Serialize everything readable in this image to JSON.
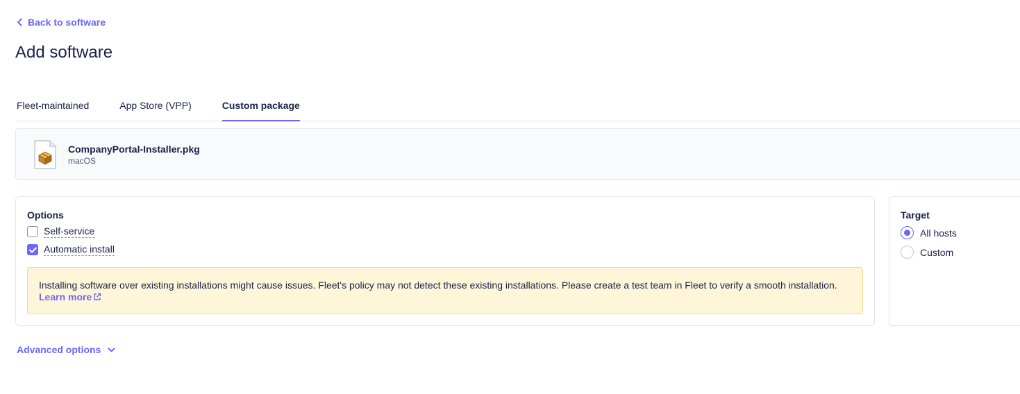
{
  "header": {
    "back_label": "Back to software",
    "title": "Add software"
  },
  "tabs": [
    {
      "label": "Fleet-maintained",
      "active": false
    },
    {
      "label": "App Store (VPP)",
      "active": false
    },
    {
      "label": "Custom package",
      "active": true
    }
  ],
  "file": {
    "name": "CompanyPortal-Installer.pkg",
    "platform": "macOS",
    "icon": "package-icon"
  },
  "options": {
    "title": "Options",
    "self_service": {
      "label": "Self-service",
      "checked": false
    },
    "automatic_install": {
      "label": "Automatic install",
      "checked": true
    },
    "warning_text": "Installing software over existing installations might cause issues. Fleet's policy may not detect these existing installations. Please create a test team in Fleet to verify a smooth installation.",
    "learn_more": "Learn more"
  },
  "target": {
    "title": "Target",
    "all_hosts": {
      "label": "All hosts",
      "selected": true
    },
    "custom": {
      "label": "Custom",
      "selected": false
    }
  },
  "advanced_label": "Advanced options",
  "colors": {
    "accent": "#6a67fe",
    "text": "#192147",
    "warning_bg": "#fff6d9",
    "border": "#e2e4ea"
  }
}
